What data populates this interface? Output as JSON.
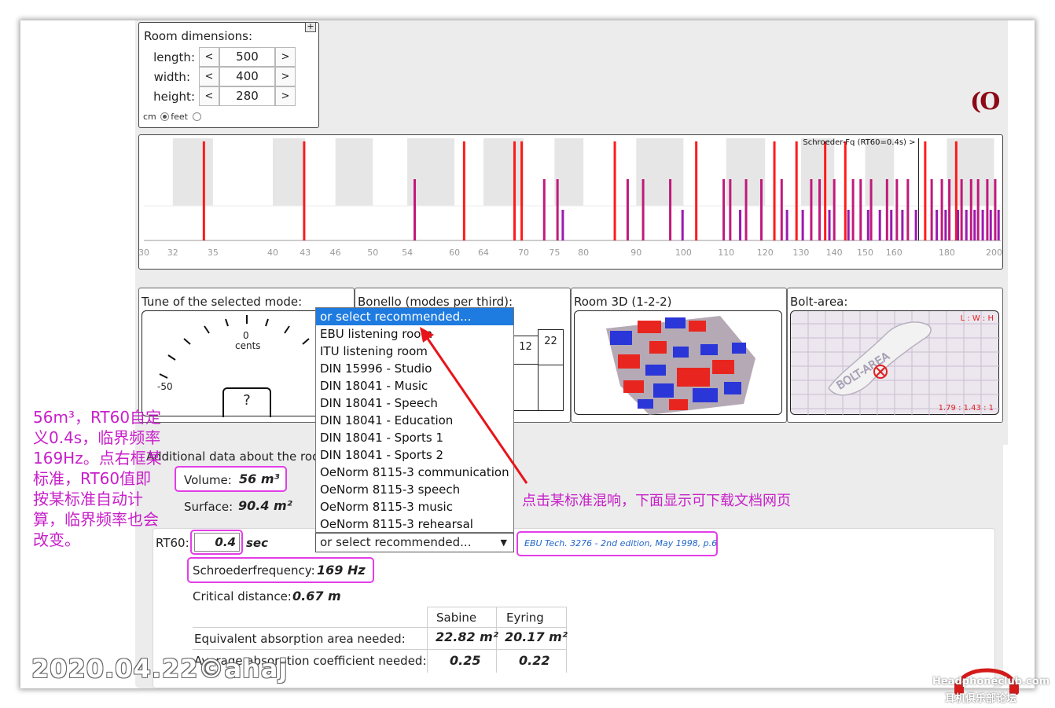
{
  "room": {
    "title": "Room dimensions:",
    "plus": "+",
    "rows": [
      {
        "label": "length:",
        "value": "500",
        "dec": "<",
        "inc": ">"
      },
      {
        "label": "width:",
        "value": "400",
        "dec": "<",
        "inc": ">"
      },
      {
        "label": "height:",
        "value": "280",
        "dec": "<",
        "inc": ">"
      }
    ],
    "unit_cm": "cm",
    "unit_feet": "feet",
    "selected_unit": "cm"
  },
  "logo": "(O",
  "chart_data": {
    "type": "bar",
    "title": "Schroeder-Fq (RT60=0.4s) >",
    "x_axis_type": "log",
    "xlim": [
      30,
      203
    ],
    "ylim": [
      0,
      1
    ],
    "tick_labels": [
      "30",
      "32",
      "35",
      "40",
      "43",
      "46",
      "50",
      "54",
      "60",
      "64",
      "70",
      "75",
      "80",
      "90",
      "100",
      "110",
      "120",
      "130",
      "140",
      "150",
      "160",
      "180",
      "200"
    ],
    "tick_values": [
      30,
      32,
      35,
      40,
      43,
      46,
      50,
      54,
      60,
      64,
      70,
      75,
      80,
      90,
      100,
      110,
      120,
      130,
      140,
      150,
      160,
      180,
      200
    ],
    "schroeder_frequency": 169,
    "colors": {
      "axial": "#ff1a1a",
      "tangential": "#c01a7a",
      "oblique": "#9a1ab0",
      "band_gray": "#e6e6e6"
    },
    "series": [
      {
        "values": [
          [
            34.3,
            0.97,
            "axial"
          ],
          [
            42.9,
            0.97,
            "axial"
          ],
          [
            61.3,
            0.97,
            "axial"
          ],
          [
            68.6,
            0.97,
            "axial"
          ],
          [
            69.7,
            0.97,
            "axial"
          ],
          [
            85.8,
            0.97,
            "axial"
          ],
          [
            102.9,
            0.97,
            "axial"
          ],
          [
            122.5,
            0.97,
            "axial"
          ],
          [
            128.7,
            0.97,
            "axial"
          ],
          [
            137.2,
            0.97,
            "axial"
          ],
          [
            143.5,
            0.97,
            "axial"
          ],
          [
            171.5,
            0.97,
            "axial"
          ],
          [
            183.8,
            0.97,
            "axial"
          ],
          [
            54.9,
            0.6,
            "tangential"
          ],
          [
            73.3,
            0.6,
            "tangential"
          ],
          [
            75.5,
            0.6,
            "tangential"
          ],
          [
            88.3,
            0.6,
            "tangential"
          ],
          [
            91.4,
            0.6,
            "tangential"
          ],
          [
            97.1,
            0.6,
            "tangential"
          ],
          [
            109.4,
            0.6,
            "tangential"
          ],
          [
            111.0,
            0.6,
            "tangential"
          ],
          [
            115.0,
            0.6,
            "tangential"
          ],
          [
            119.0,
            0.6,
            "tangential"
          ],
          [
            124.5,
            0.6,
            "tangential"
          ],
          [
            133.0,
            0.6,
            "tangential"
          ],
          [
            135.5,
            0.6,
            "tangential"
          ],
          [
            140.0,
            0.6,
            "tangential"
          ],
          [
            146.0,
            0.6,
            "tangential"
          ],
          [
            148.5,
            0.6,
            "tangential"
          ],
          [
            152.0,
            0.6,
            "tangential"
          ],
          [
            157.5,
            0.6,
            "tangential"
          ],
          [
            161.0,
            0.6,
            "tangential"
          ],
          [
            165.0,
            0.6,
            "tangential"
          ],
          [
            174.0,
            0.6,
            "tangential"
          ],
          [
            178.0,
            0.6,
            "tangential"
          ],
          [
            181.0,
            0.6,
            "tangential"
          ],
          [
            186.0,
            0.6,
            "tangential"
          ],
          [
            190.0,
            0.6,
            "tangential"
          ],
          [
            193.0,
            0.6,
            "tangential"
          ],
          [
            197.0,
            0.6,
            "tangential"
          ],
          [
            200.5,
            0.6,
            "tangential"
          ],
          [
            76.4,
            0.3,
            "oblique"
          ],
          [
            99.8,
            0.3,
            "oblique"
          ],
          [
            113.5,
            0.3,
            "oblique"
          ],
          [
            126.0,
            0.3,
            "oblique"
          ],
          [
            130.5,
            0.3,
            "oblique"
          ],
          [
            138.5,
            0.3,
            "oblique"
          ],
          [
            144.5,
            0.3,
            "oblique"
          ],
          [
            151.0,
            0.3,
            "oblique"
          ],
          [
            155.0,
            0.3,
            "oblique"
          ],
          [
            159.0,
            0.3,
            "oblique"
          ],
          [
            163.0,
            0.3,
            "oblique"
          ],
          [
            168.0,
            0.3,
            "oblique"
          ],
          [
            176.0,
            0.3,
            "oblique"
          ],
          [
            179.5,
            0.3,
            "oblique"
          ],
          [
            184.5,
            0.3,
            "oblique"
          ],
          [
            188.0,
            0.3,
            "oblique"
          ],
          [
            191.5,
            0.3,
            "oblique"
          ],
          [
            195.0,
            0.3,
            "oblique"
          ],
          [
            198.5,
            0.3,
            "oblique"
          ],
          [
            202.0,
            0.3,
            "oblique"
          ]
        ]
      }
    ]
  },
  "tune": {
    "title": "Tune of the selected mode:",
    "zero": "0",
    "cents": "cents",
    "minus50": "-50",
    "question": "?"
  },
  "bonello": {
    "title": "Bonello (modes per third):",
    "bars": [
      "12",
      "22"
    ]
  },
  "room3d": {
    "title": "Room 3D (1-2-2)"
  },
  "bolt": {
    "title": "Bolt-area:",
    "lwh": "L : W : H",
    "ratio": "1.79 : 1.43 : 1",
    "area_text": "BOLT-AREA"
  },
  "dropdown": {
    "items": [
      "or select recommended...",
      "EBU listening room",
      "ITU listening room",
      "DIN 15996 - Studio",
      "DIN 18041 - Music",
      "DIN 18041 - Speech",
      "DIN 18041 - Education",
      "DIN 18041 - Sports 1",
      "DIN 18041 - Sports 2",
      "OeNorm 8115-3 communication",
      "OeNorm 8115-3 speech",
      "OeNorm 8115-3 music",
      "OeNorm 8115-3 rehearsal"
    ],
    "selected": "or select recommended...",
    "arrow": "▼"
  },
  "additional": {
    "title": "Additional data about the room:",
    "volume_label": "Volume:",
    "volume_value": "56 m³",
    "surface_label": "Surface:",
    "surface_value": "90.4 m²",
    "rt60_label": "RT60:",
    "rt60_value": "0.4",
    "rt60_unit": "sec",
    "schroeder_label": "Schroederfrequency:",
    "schroeder_value": "169 Hz",
    "critical_label": "Critical distance:",
    "critical_value": "0.67 m",
    "link": "EBU Tech. 3276 - 2nd edition, May 1998, p.6",
    "table": {
      "headers": [
        "",
        "Sabine",
        "Eyring"
      ],
      "rows": [
        {
          "label": "Equivalent absorption area needed:",
          "sabine": "22.82 m²",
          "eyring": "20.17 m²"
        },
        {
          "label": "Average absorption coefficient needed:",
          "sabine": "0.25",
          "eyring": "0.22"
        }
      ]
    }
  },
  "annotations": {
    "left_note": [
      "56m³，RT60自定",
      "义0.4s，临界频率",
      "169Hz。点右框某",
      "标准，RT60值即",
      "按某标准自动计",
      "算，临界频率也会",
      "改变。"
    ],
    "right_note": "点击某标准混响，下面显示可下载文档网页",
    "watermark": "2020.04.22©ahaj",
    "site_top": "Headphoneclub.com",
    "site_bottom": "耳机俱乐部论坛"
  }
}
